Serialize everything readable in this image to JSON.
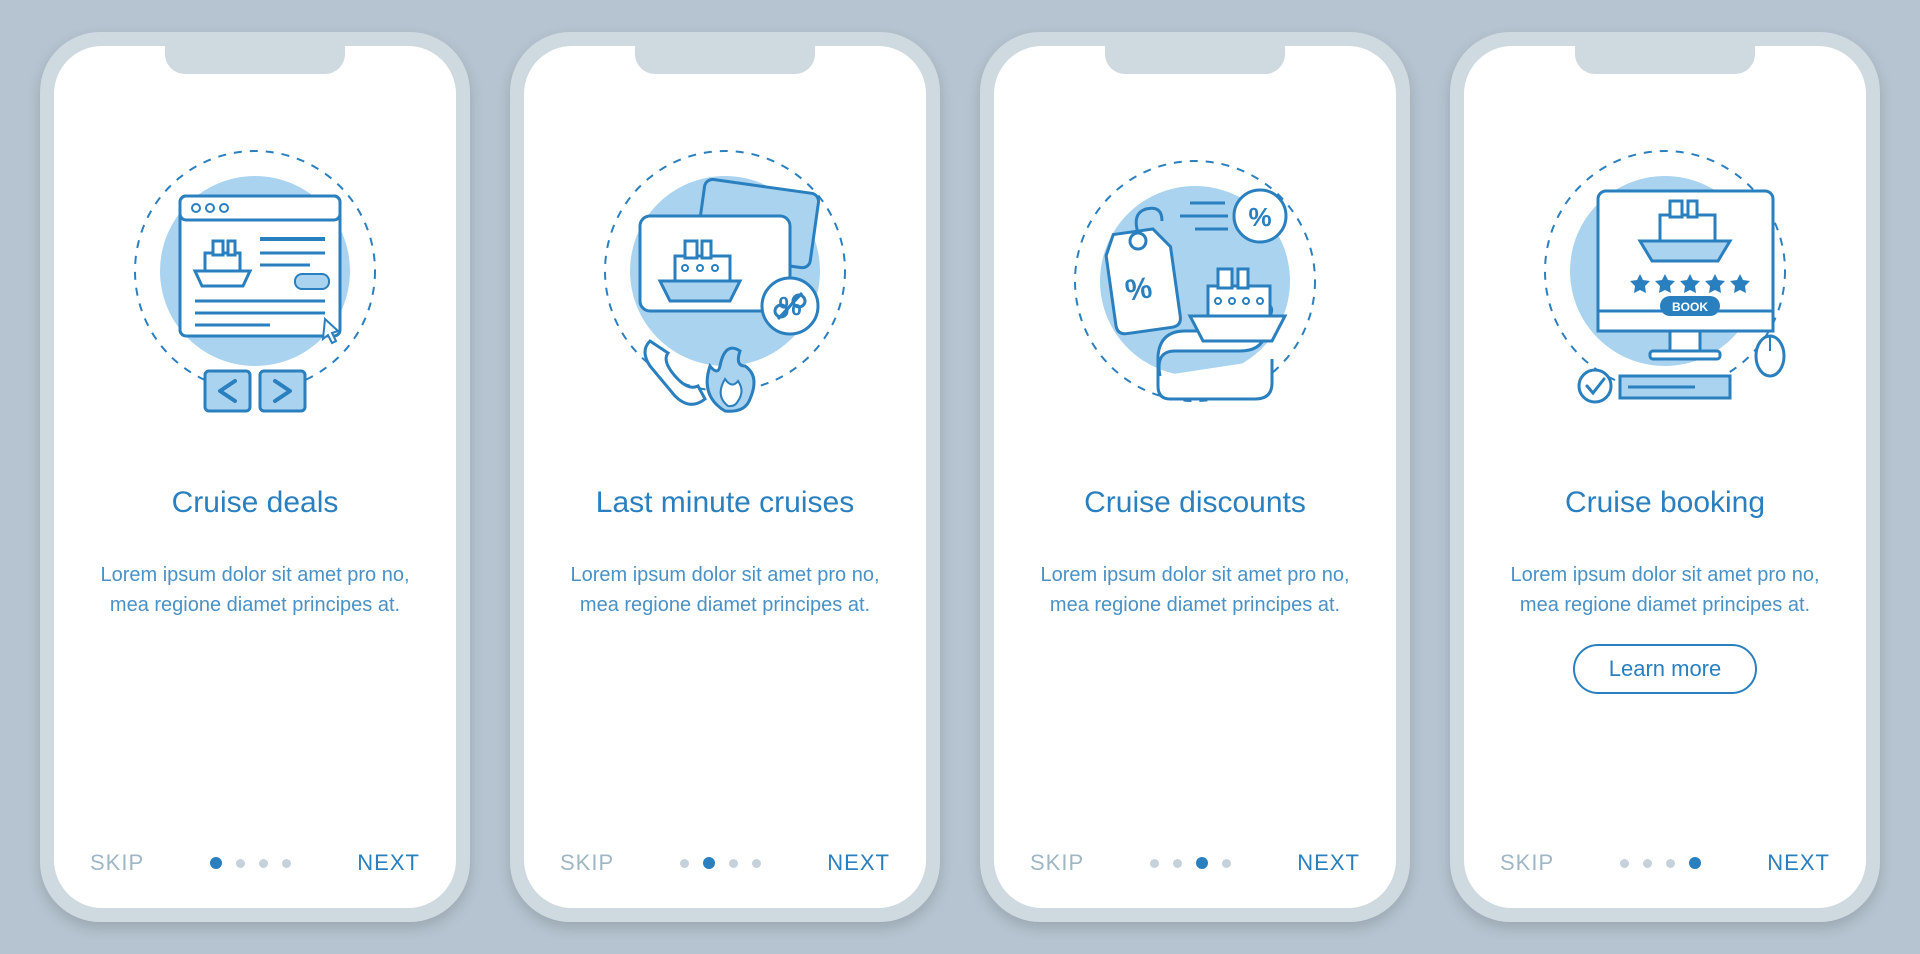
{
  "colors": {
    "accent": "#2a7fbf",
    "light": "#a9d3ef",
    "bg": "#b5c4d0"
  },
  "nav": {
    "skip": "SKIP",
    "next": "NEXT",
    "learn_more": "Learn more"
  },
  "screens": [
    {
      "title": "Cruise deals",
      "desc": "Lorem ipsum dolor sit amet pro no, mea regione diamet principes at.",
      "icon": "browser-cruise",
      "active_dot": 0,
      "button": false
    },
    {
      "title": "Last minute cruises",
      "desc": "Lorem ipsum dolor sit amet pro no, mea regione diamet principes at.",
      "icon": "tickets-hot-call",
      "active_dot": 1,
      "button": false
    },
    {
      "title": "Cruise discounts",
      "desc": "Lorem ipsum dolor sit amet pro no, mea regione diamet principes at.",
      "icon": "discount-tags-ship",
      "active_dot": 2,
      "button": false
    },
    {
      "title": "Cruise booking",
      "desc": "Lorem ipsum dolor sit amet pro no, mea regione diamet principes at.",
      "icon": "monitor-book",
      "active_dot": 3,
      "button": true
    }
  ]
}
